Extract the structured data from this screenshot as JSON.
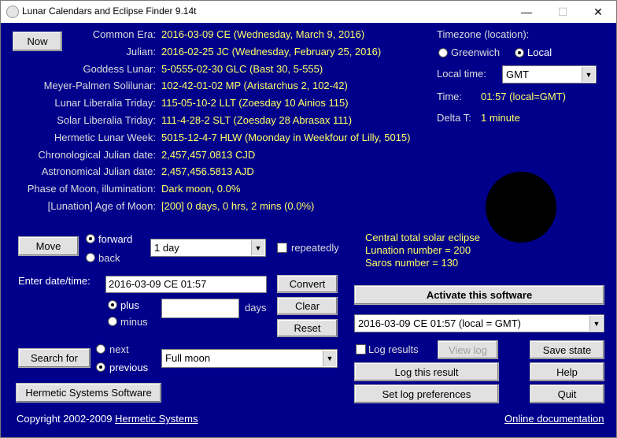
{
  "window": {
    "title": "Lunar Calendars and Eclipse Finder 9.14t",
    "minimize": "—",
    "maximize": "☐",
    "close": "✕"
  },
  "buttons": {
    "now": "Now",
    "move": "Move",
    "convert": "Convert",
    "clear": "Clear",
    "reset": "Reset",
    "search_for": "Search for",
    "hermetic": "Hermetic Systems Software",
    "activate": "Activate this software",
    "view_log": "View log",
    "save_state": "Save state",
    "log_this": "Log this result",
    "help": "Help",
    "set_log_prefs": "Set log preferences",
    "quit": "Quit"
  },
  "calendar_rows": [
    {
      "label": "Common Era:",
      "value": "2016-03-09 CE (Wednesday, March 9, 2016)"
    },
    {
      "label": "Julian:",
      "value": "2016-02-25 JC (Wednesday, February 25, 2016)"
    },
    {
      "label": "Goddess Lunar:",
      "value": "5-0555-02-30 GLC (Bast 30, 5-555)"
    },
    {
      "label": "Meyer-Palmen Solilunar:",
      "value": "102-42-01-02 MP (Aristarchus 2, 102-42)"
    },
    {
      "label": "Lunar Liberalia Triday:",
      "value": "115-05-10-2 LLT (Zoesday 10 Ainios 115)"
    },
    {
      "label": "Solar Liberalia Triday:",
      "value": "111-4-28-2 SLT (Zoesday 28 Abrasax 111)"
    },
    {
      "label": "Hermetic Lunar Week:",
      "value": "5015-12-4-7 HLW (Moonday in Weekfour of Lilly, 5015)"
    },
    {
      "label": "Chronological Julian date:",
      "value": "2,457,457.0813 CJD"
    },
    {
      "label": "Astronomical Julian date:",
      "value": "2,457,456.5813 AJD"
    },
    {
      "label": "Phase of Moon, illumination:",
      "value": "Dark moon, 0.0%"
    },
    {
      "label": "[Lunation] Age of Moon:",
      "value": "[200] 0 days, 0 hrs, 2 mins (0.0%)"
    }
  ],
  "timezone": {
    "heading": "Timezone (location):",
    "greenwich": "Greenwich",
    "local": "Local",
    "local_time_label": "Local time:",
    "local_time_value": "GMT",
    "time_label": "Time:",
    "time_value": "01:57 (local=GMT)",
    "delta_label": "Delta T:",
    "delta_value": "1 minute"
  },
  "move": {
    "forward": "forward",
    "back": "back",
    "step": "1 day",
    "repeatedly": "repeatedly"
  },
  "entry": {
    "label": "Enter date/time:",
    "value": "2016-03-09 CE 01:57",
    "plus": "plus",
    "minus": "minus",
    "days_value": "",
    "days_label": "days"
  },
  "search": {
    "next": "next",
    "previous": "previous",
    "target": "Full moon"
  },
  "eclipse": {
    "line1": "Central total solar eclipse",
    "line2": "Lunation number = 200",
    "line3": "Saros number = 130"
  },
  "result_select": "2016-03-09 CE 01:57 (local = GMT)",
  "log_results": "Log results",
  "footer": {
    "copyright": "Copyright 2002-2009",
    "company_link": "Hermetic Systems",
    "docs_link": "Online documentation"
  },
  "colors": {
    "background": "#00008b",
    "value_text": "#ffff66",
    "label_text": "#dcdcdc",
    "moon": "#000000"
  }
}
